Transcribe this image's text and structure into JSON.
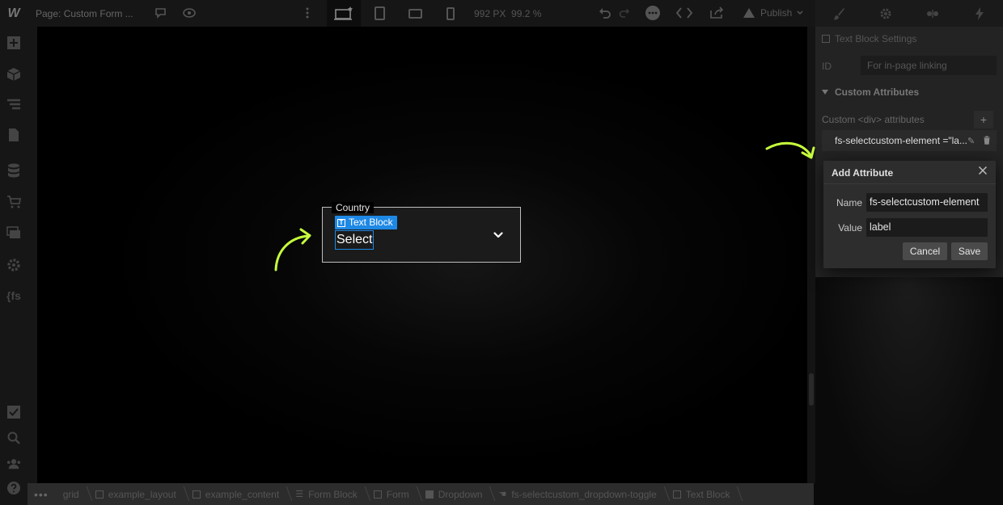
{
  "topbar": {
    "logo": "W",
    "page_label": "Page: Custom Form ...",
    "size_px": "992 PX",
    "zoom": "99.2 %",
    "publish_label": "Publish"
  },
  "canvas": {
    "fieldset_legend": "Country",
    "text_block_tag": "Text Block",
    "select_text": "Select"
  },
  "breadcrumb": {
    "items": [
      "grid",
      "example_layout",
      "example_content",
      "Form Block",
      "Form",
      "Dropdown",
      "fs-selectcustom_dropdown-toggle",
      "Text Block"
    ]
  },
  "right_panel": {
    "settings_title": "Text Block Settings",
    "id_label": "ID",
    "id_placeholder": "For in-page linking",
    "section_title": "Custom Attributes",
    "custom_label": "Custom <div> attributes",
    "attribute_row": "fs-selectcustom-element =\"la..."
  },
  "dialog": {
    "title": "Add Attribute",
    "name_label": "Name",
    "name_value": "fs-selectcustom-element",
    "value_label": "Value",
    "value_value": "label",
    "cancel_label": "Cancel",
    "save_label": "Save"
  },
  "colors": {
    "accent_blue": "#1e88e5",
    "arrow_green": "#c6ff3d"
  }
}
